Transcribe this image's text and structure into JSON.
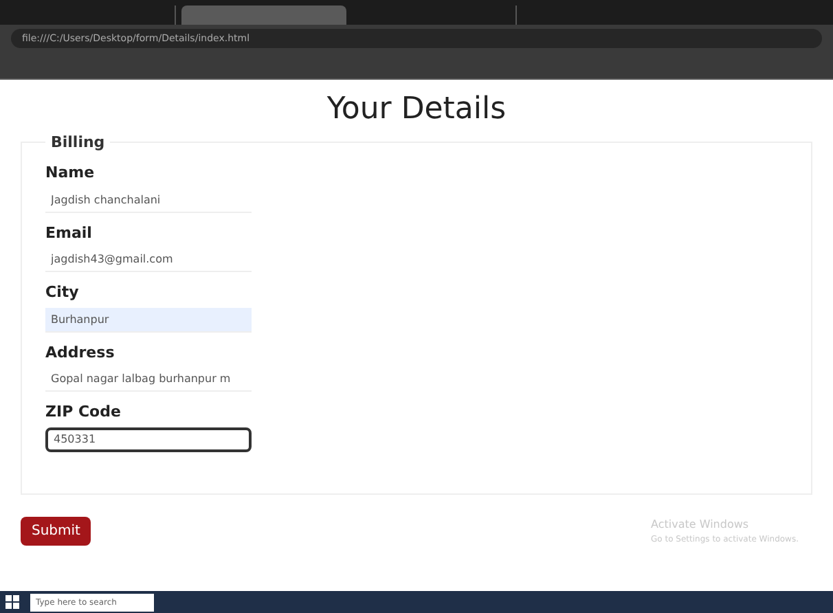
{
  "browser": {
    "tabs": [
      {
        "selected": false
      },
      {
        "selected": true
      },
      {
        "selected": false
      }
    ],
    "address": "file:///C:/Users/Desktop/form/Details/index.html"
  },
  "page": {
    "title": "Your Details",
    "legend": "Billing",
    "fields": [
      {
        "label": "Name",
        "value": "Jagdish chanchalani",
        "autofilled": false,
        "focused": false
      },
      {
        "label": "Email",
        "value": "jagdish43@gmail.com",
        "autofilled": false,
        "focused": false
      },
      {
        "label": "City",
        "value": "Burhanpur",
        "autofilled": true,
        "focused": false
      },
      {
        "label": "Address",
        "value": "Gopal nagar lalbag burhanpur m",
        "autofilled": false,
        "focused": false
      },
      {
        "label": "ZIP Code",
        "value": "450331",
        "autofilled": false,
        "focused": true
      }
    ],
    "submit": "Submit"
  },
  "activation": {
    "title": "Activate Windows",
    "subtitle": "Go to Settings to activate Windows."
  },
  "taskbar": {
    "search_placeholder": "Type here to search"
  }
}
